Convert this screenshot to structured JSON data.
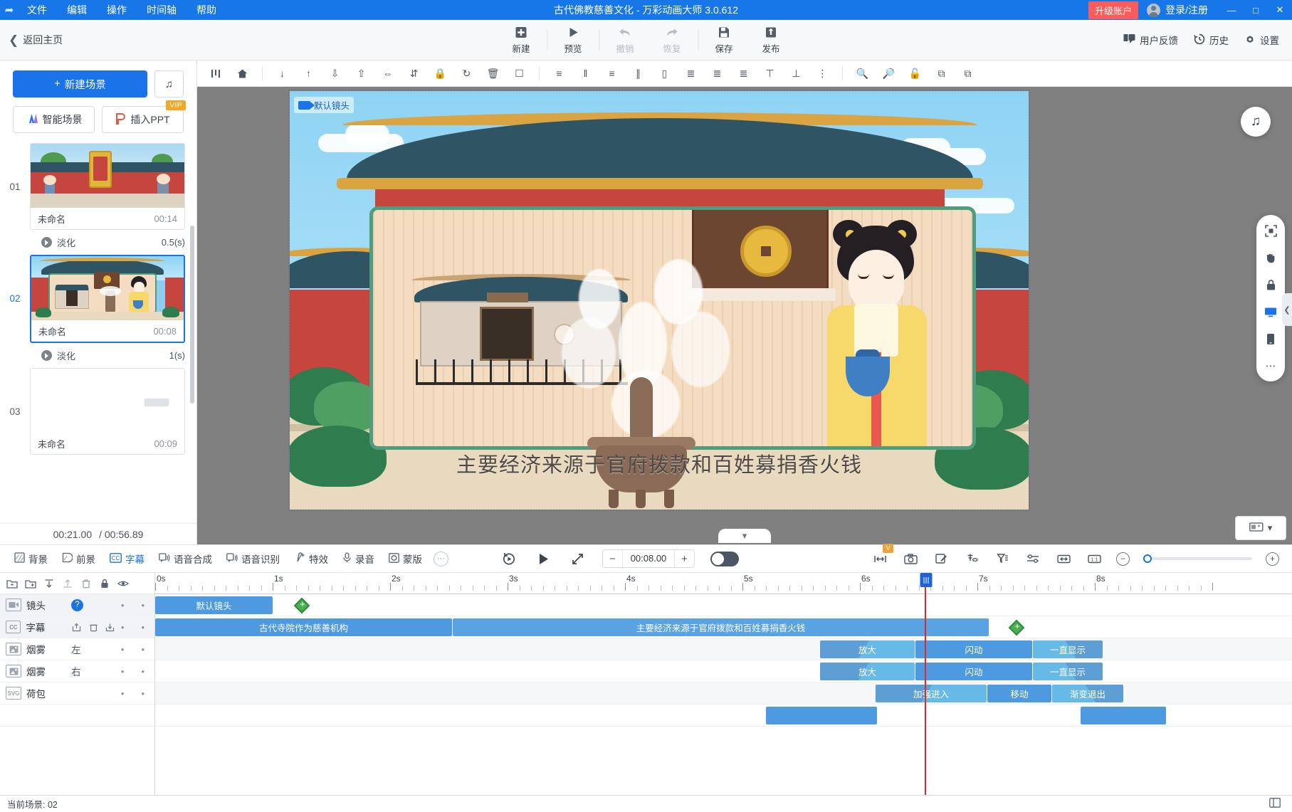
{
  "titlebar": {
    "menu": [
      "文件",
      "编辑",
      "操作",
      "时间轴",
      "帮助"
    ],
    "title": "古代佛教慈善文化 - 万彩动画大师 3.0.612",
    "upgrade_label": "升级账户",
    "login_label": "登录/注册",
    "minimize": "—",
    "maximize": "□",
    "close": "✕",
    "accent": "#1877e8",
    "upgrade_color": "#ff5b5b"
  },
  "toolbar": {
    "back_label": "返回主页",
    "buttons": [
      {
        "label": "新建",
        "icon": "plus-square-icon",
        "disabled": false
      },
      {
        "label": "预览",
        "icon": "play-icon",
        "disabled": false
      },
      {
        "label": "撤销",
        "icon": "undo-arrow-icon",
        "disabled": true
      },
      {
        "label": "恢复",
        "icon": "redo-arrow-icon",
        "disabled": true
      },
      {
        "label": "保存",
        "icon": "floppy-disk-icon",
        "disabled": false
      },
      {
        "label": "发布",
        "icon": "upload-box-icon",
        "disabled": false
      }
    ],
    "right_items": [
      {
        "label": "用户反馈",
        "icon": "feedback-icon"
      },
      {
        "label": "历史",
        "icon": "history-clock-icon"
      },
      {
        "label": "设置",
        "icon": "gear-icon"
      }
    ]
  },
  "scene_panel": {
    "new_scene_label": "新建场景",
    "music_icon": "music-note-icon",
    "smart_scene_label": "智能场景",
    "insert_ppt_label": "插入PPT",
    "vip_badge": "VIP",
    "scenes": [
      {
        "num": "01",
        "name": "未命名",
        "duration": "00:14",
        "transition": "淡化",
        "transition_time": "0.5(s)",
        "selected": false
      },
      {
        "num": "02",
        "name": "未命名",
        "duration": "00:08",
        "transition": "淡化",
        "transition_time": "1(s)",
        "selected": true
      },
      {
        "num": "03",
        "name": "未命名",
        "duration": "00:09",
        "transition": "",
        "transition_time": "",
        "selected": false
      }
    ],
    "current_time": "00:21.00",
    "total_time": "/ 00:56.89"
  },
  "canvas": {
    "camera_tag": "默认镜头",
    "subtitle_text": "主要经济来源于官府拨款和百姓募捐香火钱",
    "music_fab_icon": "music-note-icon",
    "rail_icons": [
      "fit-frame-icon",
      "pan-hand-icon",
      "lock-icon",
      "screen-icon",
      "mobile-icon",
      "more-dots-icon"
    ],
    "collapse_icon": "chevron-down-icon",
    "thumb_icon": "filmstrip-icon"
  },
  "edit_bar": {
    "items": [
      {
        "label": "背景",
        "icon": "background-icon",
        "active": false
      },
      {
        "label": "前景",
        "icon": "foreground-icon",
        "active": false
      },
      {
        "label": "字幕",
        "icon": "cc-subtitle-icon",
        "active": true
      },
      {
        "label": "语音合成",
        "icon": "tts-icon",
        "active": false
      },
      {
        "label": "语音识别",
        "icon": "asr-icon",
        "active": false
      },
      {
        "label": "特效",
        "icon": "sparkle-icon",
        "active": false
      },
      {
        "label": "录音",
        "icon": "microphone-icon",
        "active": false
      },
      {
        "label": "蒙版",
        "icon": "mask-icon",
        "active": false
      }
    ],
    "more_label": "···",
    "replay_icon": "replay-icon",
    "play_icon": "play-icon",
    "fullscreen_icon": "expand-arrows-icon",
    "minus_label": "−",
    "duration_value": "00:08.00",
    "plus_label": "+",
    "toggle_state": "off",
    "right_icons": [
      "fit-width-icon",
      "camera-snapshot-icon",
      "edit-pen-icon",
      "magnet-icon",
      "filter-icon",
      "settings-sliders-icon",
      "fit-timeline-icon",
      "one-to-one-icon"
    ],
    "zoom_out_label": "−",
    "zoom_in_label": "+",
    "zoom_value": 0
  },
  "timeline": {
    "head_icons": [
      "import-folder-icon",
      "new-folder-icon",
      "move-down-icon",
      "move-up-icon",
      "trash-icon",
      "lock-icon",
      "eye-icon"
    ],
    "ruler_labels": [
      "0s",
      "1s",
      "2s",
      "3s",
      "4s",
      "5s",
      "6s",
      "7s",
      "8s"
    ],
    "playhead_time_s": 6.55,
    "tracks": [
      {
        "name": "镜头",
        "sub": "",
        "icon": "camera-track-icon",
        "has_help": true,
        "highlight": true,
        "clips": [
          {
            "label": "默认镜头",
            "start_s": 0.0,
            "end_s": 1.0,
            "style": "blue"
          }
        ],
        "keyframes": [
          1.33
        ]
      },
      {
        "name": "字幕",
        "sub": "",
        "icon": "cc-subtitle-icon",
        "has_help": false,
        "highlight": true,
        "extra_icons": [
          "export-icon",
          "trash-icon",
          "import-icon"
        ],
        "clips": [
          {
            "label": "古代寺院作为慈善机构",
            "start_s": 0.0,
            "end_s": 2.53,
            "style": "blue"
          },
          {
            "label": "主要经济来源于官府拨款和百姓募捐香火钱",
            "start_s": 2.53,
            "end_s": 7.0,
            "style": "blue2"
          }
        ],
        "keyframes": [
          7.2
        ]
      },
      {
        "name": "烟雾",
        "sub": "左",
        "icon": "image-track-icon",
        "has_help": false,
        "highlight": false,
        "clips": [
          {
            "label": "放大",
            "start_s": 5.95,
            "end_s": 6.52,
            "style": "anim-in"
          },
          {
            "label": "闪动",
            "start_s": 6.52,
            "end_s": 7.53,
            "style": "anim-mid"
          },
          {
            "label": "一直显示",
            "start_s": 7.53,
            "end_s": 8.1,
            "style": "anim-out"
          }
        ],
        "keyframes": []
      },
      {
        "name": "烟雾",
        "sub": "右",
        "icon": "image-track-icon",
        "has_help": false,
        "highlight": false,
        "clips": [
          {
            "label": "放大",
            "start_s": 5.95,
            "end_s": 6.52,
            "style": "anim-in"
          },
          {
            "label": "闪动",
            "start_s": 6.52,
            "end_s": 7.53,
            "style": "anim-mid"
          },
          {
            "label": "一直显示",
            "start_s": 7.53,
            "end_s": 8.1,
            "style": "anim-out"
          }
        ],
        "keyframes": []
      },
      {
        "name": "荷包",
        "sub": "",
        "icon": "svg-track-icon",
        "has_help": false,
        "highlight": false,
        "clips": [
          {
            "label": "加强进入",
            "start_s": 6.28,
            "end_s": 7.2,
            "style": "anim-in"
          },
          {
            "label": "移动",
            "start_s": 7.2,
            "end_s": 7.72,
            "style": "anim-mid"
          },
          {
            "label": "渐变退出",
            "start_s": 7.72,
            "end_s": 8.2,
            "style": "anim-out"
          }
        ],
        "keyframes": []
      },
      {
        "name": "",
        "sub": "",
        "icon": "",
        "has_help": false,
        "highlight": false,
        "clips": [
          {
            "label": "",
            "start_s": 5.6,
            "end_s": 6.55,
            "style": "blue"
          },
          {
            "label": "",
            "start_s": 7.45,
            "end_s": 8.2,
            "style": "blue"
          }
        ],
        "keyframes": []
      }
    ]
  },
  "status_bar": {
    "current_scene_label": "当前场景: 02",
    "right_icon": "layout-icon"
  }
}
